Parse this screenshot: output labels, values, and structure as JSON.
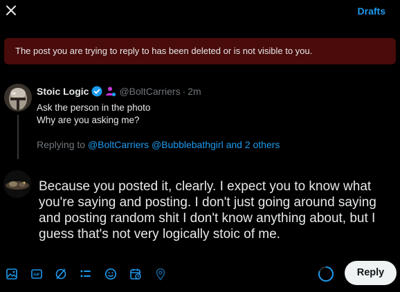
{
  "header": {
    "drafts_label": "Drafts"
  },
  "banner": {
    "text": "The post you are trying to reply to has been deleted or is not visible to you."
  },
  "original_post": {
    "display_name": "Stoic Logic",
    "handle": "@BoltCarriers",
    "separator": "·",
    "time": "2m",
    "lines": [
      "Ask the person in the photo",
      "Why are you asking me?"
    ],
    "replying_prefix": "Replying to ",
    "replying_mentions": [
      "@BoltCarriers",
      "@Bubblebathgirl"
    ],
    "replying_and": " and ",
    "replying_others": "2 others"
  },
  "compose": {
    "text": "Because you posted it, clearly.  I expect you to know what you're saying and posting. I don't just going around saying and posting random shit I don't know anything about, but I guess that's not very logically stoic of me."
  },
  "toolbar": {
    "reply_label": "Reply",
    "icons": [
      "image-icon",
      "gif-icon",
      "grok-icon",
      "poll-icon",
      "emoji-icon",
      "schedule-icon",
      "location-icon"
    ]
  },
  "colors": {
    "accent": "#1d9bf0",
    "banner_bg": "#4a0b0b",
    "muted": "#71767b",
    "text": "#e7e9ea",
    "affiliation": "#c936d9"
  }
}
